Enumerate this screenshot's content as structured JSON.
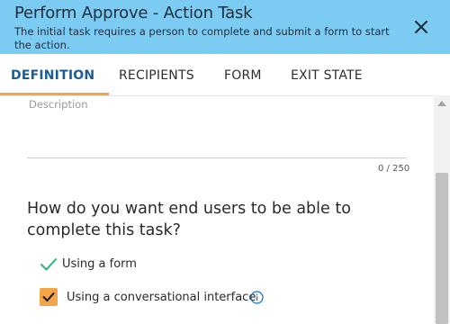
{
  "header": {
    "title": "Perform Approve - Action Task",
    "subtitle": "The initial task requires a person to complete and submit a form to start the action.",
    "background": "#7ccbf3"
  },
  "tabs": [
    {
      "label": "DEFINITION",
      "active": true
    },
    {
      "label": "RECIPIENTS",
      "active": false
    },
    {
      "label": "FORM",
      "active": false
    },
    {
      "label": "EXIT STATE",
      "active": false
    }
  ],
  "description": {
    "label": "Description",
    "char_count": "0 / 250"
  },
  "question": "How do you want end users to be able to complete this task?",
  "options": [
    {
      "label": "Using a form",
      "icon": "green-check-icon"
    },
    {
      "label": "Using a conversational interface",
      "checked": true,
      "icon": "info-icon"
    }
  ],
  "colors": {
    "accent": "#f2a447",
    "active_tab": "#1b5c97",
    "check": "#2bb673"
  }
}
